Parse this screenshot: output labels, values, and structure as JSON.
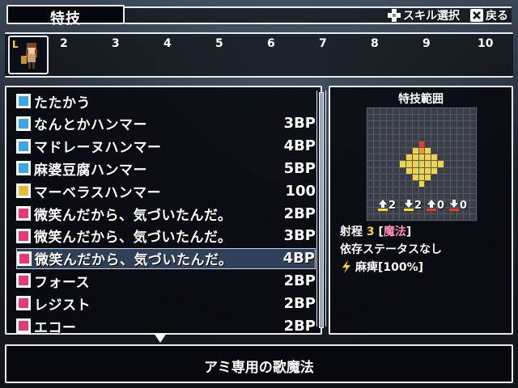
{
  "header": {
    "title": "特技",
    "hints": [
      {
        "icon": "dpad-icon",
        "label": "スキル選択"
      },
      {
        "icon": "x-button-icon",
        "label": "戻る"
      }
    ]
  },
  "party": {
    "leader_marker": "L",
    "slot_numbers": [
      "2",
      "3",
      "4",
      "5",
      "6",
      "7",
      "8",
      "9",
      "10"
    ]
  },
  "skills": [
    {
      "name": "たたかう",
      "cost": "",
      "icon": "sword-icon",
      "color": "#38a8e8"
    },
    {
      "name": "なんとかハンマー",
      "cost": "3BP",
      "icon": "hammer-skill-icon",
      "color": "#38a8e8"
    },
    {
      "name": "マドレーヌハンマー",
      "cost": "4BP",
      "icon": "hammer-skill-icon",
      "color": "#38a8e8"
    },
    {
      "name": "麻婆豆腐ハンマー",
      "cost": "5BP",
      "icon": "hammer-skill-icon",
      "color": "#38a8e8"
    },
    {
      "name": "マーベラスハンマー",
      "cost": "100",
      "icon": "marvelous-icon",
      "color": "#e8b838"
    },
    {
      "name": "微笑んだから、気づいたんだ。",
      "cost": "2BP",
      "icon": "music-note-icon",
      "color": "#e83878"
    },
    {
      "name": "微笑んだから、気づいたんだ。",
      "cost": "3BP",
      "icon": "music-note-plus-icon",
      "color": "#e83878"
    },
    {
      "name": "微笑んだから、気づいたんだ。",
      "cost": "4BP",
      "icon": "music-note-plus2-icon",
      "color": "#e83878"
    },
    {
      "name": "フォース",
      "cost": "2BP",
      "icon": "vo-icon",
      "color": "#e83878"
    },
    {
      "name": "レジスト",
      "cost": "2BP",
      "icon": "vo-icon",
      "color": "#e83878"
    },
    {
      "name": "エコー",
      "cost": "2BP",
      "icon": "vo-icon",
      "color": "#e83878"
    }
  ],
  "selected_index": 7,
  "range_panel": {
    "title": "特技範囲",
    "stats": [
      {
        "icon": "attack-up-icon",
        "value": "2"
      },
      {
        "icon": "defense-up-icon",
        "value": "2"
      },
      {
        "icon": "magic-up-icon",
        "value": "0"
      },
      {
        "icon": "speed-down-icon",
        "value": "0"
      }
    ],
    "range_label": "射程",
    "range_value": "3",
    "range_type": "魔法",
    "dependency": "依存ステータスなし",
    "effect": "麻痺[100%]"
  },
  "description": "アミ専用の歌魔法"
}
